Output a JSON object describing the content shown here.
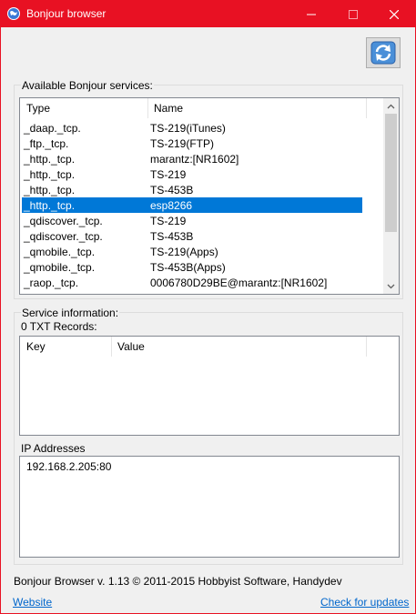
{
  "window": {
    "title": "Bonjour browser"
  },
  "services": {
    "label": "Available Bonjour services:",
    "columns": {
      "type": "Type",
      "name": "Name"
    },
    "rows": [
      {
        "type": "_daap._tcp.",
        "name": "TS-219(iTunes)"
      },
      {
        "type": "_ftp._tcp.",
        "name": "TS-219(FTP)"
      },
      {
        "type": "_http._tcp.",
        "name": "marantz:[NR1602]"
      },
      {
        "type": "_http._tcp.",
        "name": "TS-219"
      },
      {
        "type": "_http._tcp.",
        "name": "TS-453B"
      },
      {
        "type": "_http._tcp.",
        "name": "esp8266"
      },
      {
        "type": "_qdiscover._tcp.",
        "name": "TS-219"
      },
      {
        "type": "_qdiscover._tcp.",
        "name": "TS-453B"
      },
      {
        "type": "_qmobile._tcp.",
        "name": "TS-219(Apps)"
      },
      {
        "type": "_qmobile._tcp.",
        "name": "TS-453B(Apps)"
      },
      {
        "type": "_raop._tcp.",
        "name": "0006780D29BE@marantz:[NR1602]"
      }
    ],
    "selected_index": 5
  },
  "service_info": {
    "label": "Service information:",
    "txt_records_label": "0 TXT Records:",
    "columns": {
      "key": "Key",
      "value": "Value"
    },
    "ip_label": "IP Addresses",
    "ip_addresses": [
      "192.168.2.205:80"
    ]
  },
  "footer": {
    "about": "Bonjour Browser v. 1.13 © 2011-2015 Hobbyist Software, Handydev",
    "website_link": "Website",
    "updates_link": "Check for updates"
  },
  "colors": {
    "accent": "#e81123",
    "selection": "#0078d7",
    "link": "#0066cc"
  }
}
